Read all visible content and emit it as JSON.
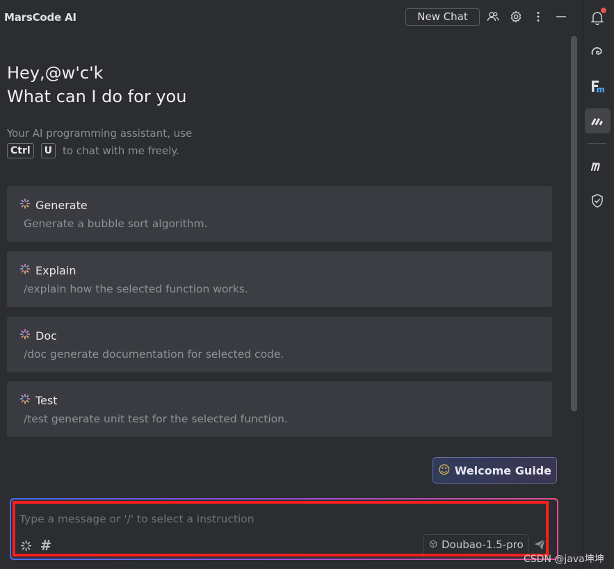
{
  "header": {
    "app_title": "MarsCode AI",
    "new_chat_label": "New Chat",
    "icons": [
      "users-icon",
      "gear-icon",
      "more-vertical-icon",
      "minimize-icon"
    ]
  },
  "greeting": {
    "line1": "Hey,@w'c'k",
    "line2": "What can I do for you"
  },
  "intro": {
    "line1": "Your AI programming assistant, use",
    "key1": "Ctrl",
    "key2": "U",
    "line2_suffix": "to chat with me freely."
  },
  "cards": [
    {
      "title": "Generate",
      "desc": "Generate a bubble sort algorithm."
    },
    {
      "title": "Explain",
      "desc": "/explain how the selected function works."
    },
    {
      "title": "Doc",
      "desc": "/doc generate documentation for selected code."
    },
    {
      "title": "Test",
      "desc": "/test generate unit test for the selected function."
    }
  ],
  "welcome_guide": {
    "emoji": "☺",
    "label": "Welcome Guide"
  },
  "input": {
    "placeholder": "Type a message or '/' to select a instruction",
    "value": "",
    "hash_symbol": "#",
    "model": "Doubao-1.5-pro"
  },
  "watermark": "CSDN @java坤坤",
  "colors": {
    "background": "#2b2d30",
    "card": "#393b40",
    "highlight": "#ff1e1e",
    "notification_dot": "#e5534b"
  },
  "rail": {
    "icons": [
      "notifications-icon",
      "swirl-plugin-icon",
      "fm-plugin-icon",
      "marscode-icon",
      "m-plugin-icon",
      "shield-check-icon"
    ],
    "active": "marscode-icon"
  }
}
